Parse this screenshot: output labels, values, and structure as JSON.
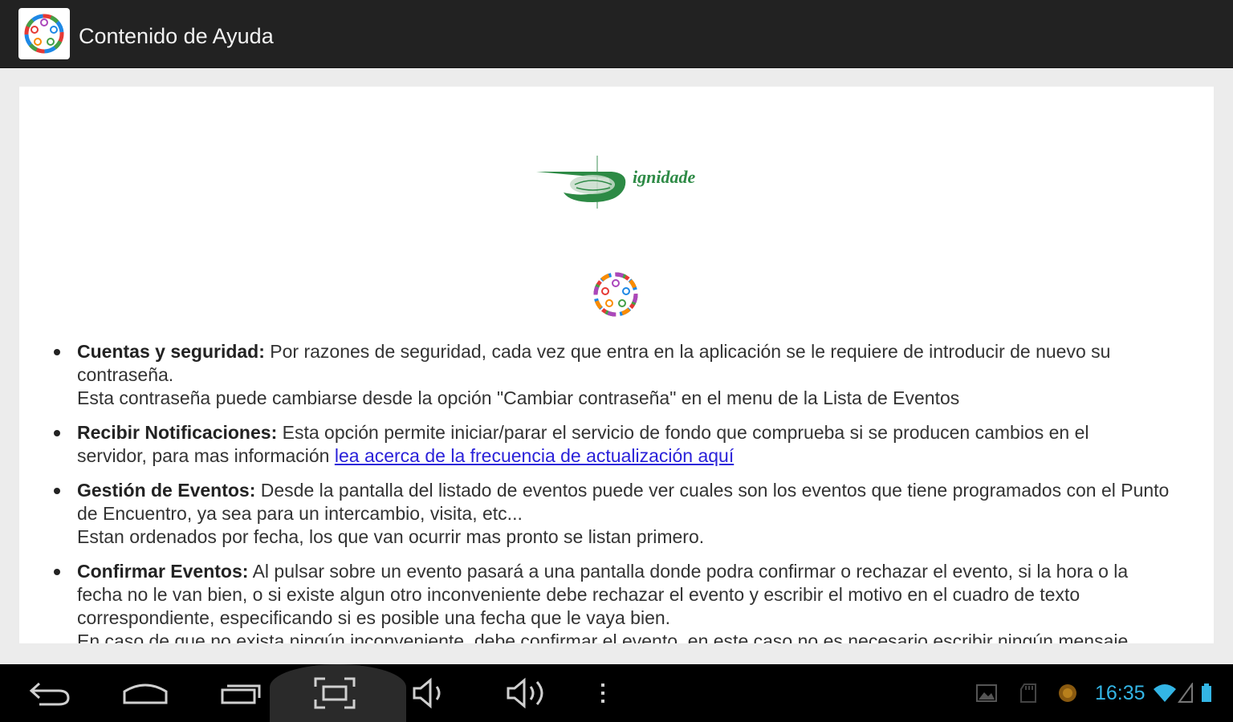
{
  "window": {
    "title": "Contenido de Ayuda"
  },
  "colors": {
    "link": "#2b22d9",
    "clock": "#33b5e5",
    "logo_green": "#2d8a45"
  },
  "logos": {
    "brand_text": "ignidade"
  },
  "help_items": [
    {
      "title": "Cuentas y seguridad:",
      "line1": "Por razones de seguridad, cada vez que entra en la aplicación se le requiere de introducir de nuevo su",
      "line2": "contraseña.",
      "line3": "Esta contraseña puede cambiarse desde la opción \"Cambiar contraseña\" en el menu de la Lista de Eventos"
    },
    {
      "title": "Recibir Notificaciones:",
      "line1": "Esta opción permite iniciar/parar el servicio de fondo que comprueba si se producen cambios en el",
      "line2": "servidor, para mas información",
      "link": "lea acerca de la frecuencia de actualización aquí"
    },
    {
      "title": "Gestión de Eventos:",
      "line1": "Desde la pantalla del listado de eventos puede ver cuales son los eventos que tiene programados con el Punto",
      "line2": "de Encuentro, ya sea para un intercambio, visita, etc...",
      "line3": "Estan ordenados por fecha, los que van ocurrir mas pronto se listan primero."
    },
    {
      "title": "Confirmar Eventos:",
      "line1": "Al pulsar sobre un evento pasará a una pantalla donde podra confirmar o rechazar el evento, si la hora o la",
      "line2": "fecha no le van bien, o si existe algun otro inconveniente debe rechazar el evento y escribir el motivo en el cuadro de texto",
      "line3": "correspondiente, especificando si es posible una fecha que le vaya bien.",
      "line4": "En caso de que no exista ningún inconveniente, debe confirmar el evento, en este caso no es necesario escribir ningún mensaje"
    }
  ],
  "nav_bar": {
    "buttons": [
      "back-icon",
      "home-icon",
      "recent-apps-icon",
      "screenshot-icon",
      "volume-down-icon",
      "volume-up-icon",
      "menu-icon"
    ],
    "status_icons": [
      "gallery-icon",
      "sd-card-icon",
      "notification-icon",
      "wifi-icon",
      "signal-icon",
      "battery-icon"
    ],
    "time": "16:35"
  }
}
